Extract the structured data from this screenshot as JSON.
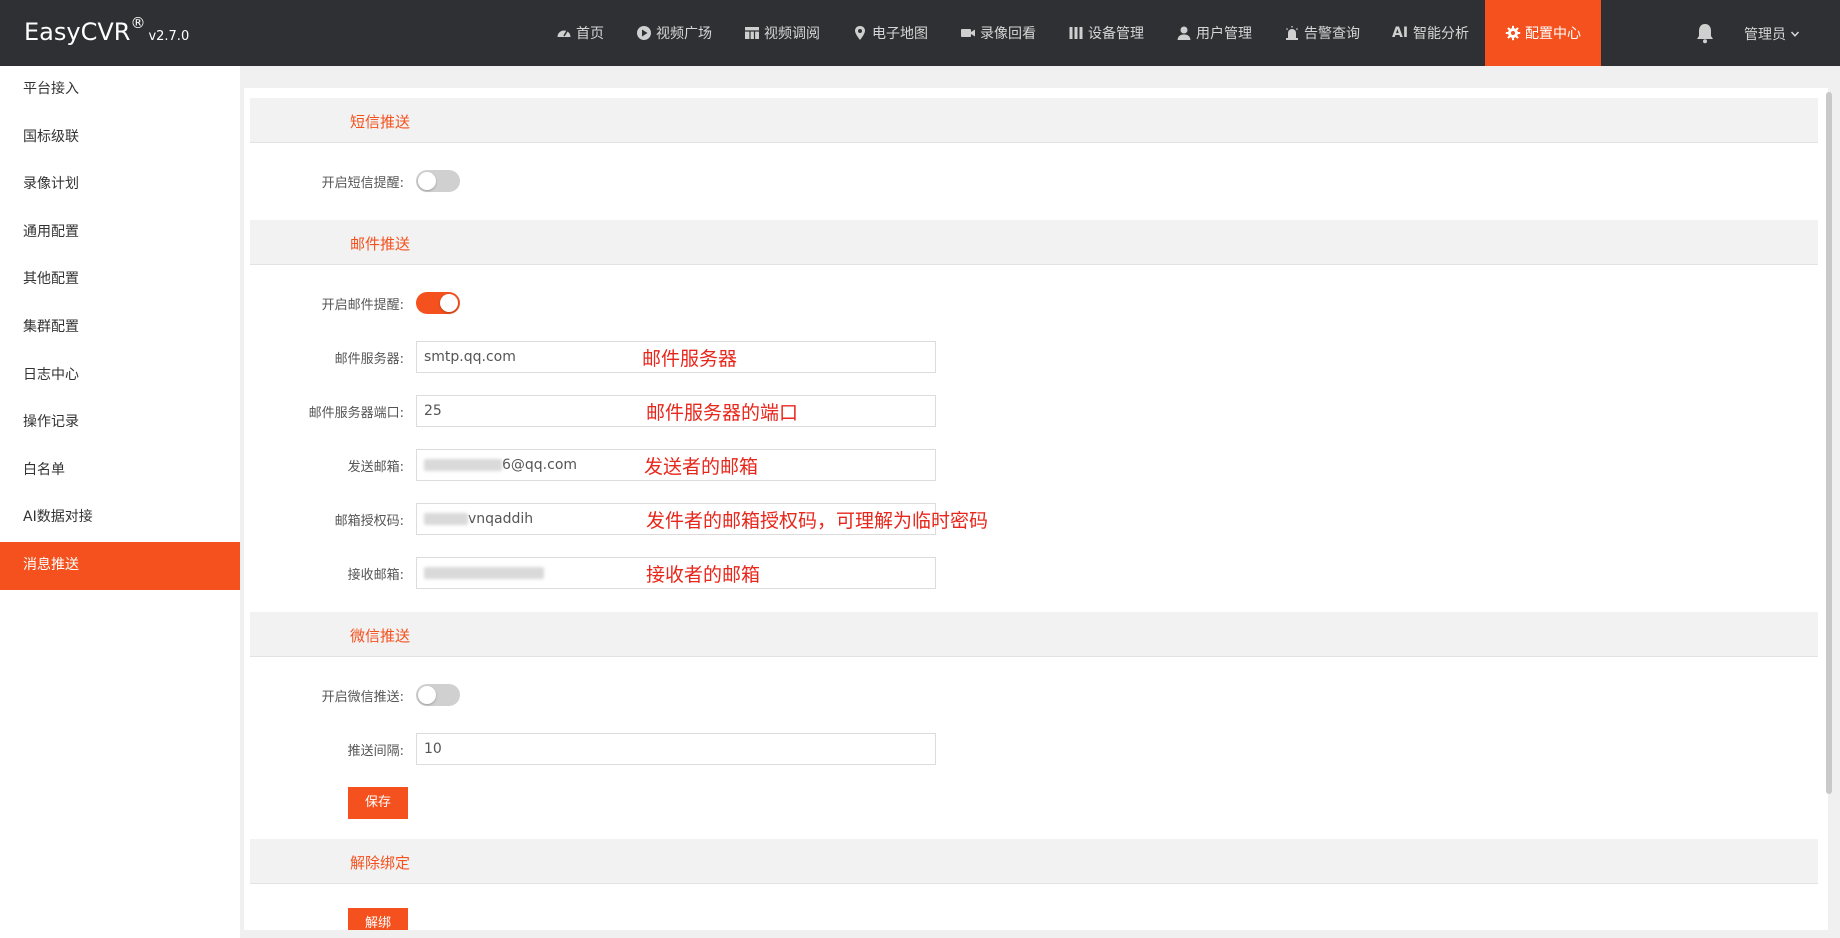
{
  "app": {
    "brand": "EasyCVR",
    "brand_mark": "®",
    "version": "v2.7.0"
  },
  "nav": [
    {
      "label": "首页",
      "icon": "dashboard-icon"
    },
    {
      "label": "视频广场",
      "icon": "play-circle-icon"
    },
    {
      "label": "视频调阅",
      "icon": "grid-icon"
    },
    {
      "label": "电子地图",
      "icon": "map-pin-icon"
    },
    {
      "label": "录像回看",
      "icon": "video-camera-icon"
    },
    {
      "label": "设备管理",
      "icon": "device-icon"
    },
    {
      "label": "用户管理",
      "icon": "user-icon"
    },
    {
      "label": "告警查询",
      "icon": "alarm-icon"
    },
    {
      "label": "智能分析",
      "icon": "ai-icon",
      "icon_text": "AI"
    },
    {
      "label": "配置中心",
      "icon": "gear-icon"
    }
  ],
  "user": {
    "label": "管理员",
    "icon": "chevron-down-icon"
  },
  "sidebar": {
    "items": [
      {
        "label": "平台接入"
      },
      {
        "label": "国标级联"
      },
      {
        "label": "录像计划"
      },
      {
        "label": "通用配置"
      },
      {
        "label": "其他配置"
      },
      {
        "label": "集群配置"
      },
      {
        "label": "日志中心"
      },
      {
        "label": "操作记录"
      },
      {
        "label": "白名单"
      },
      {
        "label": "AI数据对接"
      },
      {
        "label": "消息推送"
      }
    ]
  },
  "sms": {
    "title": "短信推送",
    "enable_label": "开启短信提醒:",
    "enabled": false
  },
  "email": {
    "title": "邮件推送",
    "enable_label": "开启邮件提醒:",
    "enabled": true,
    "server_label": "邮件服务器:",
    "server_value": "smtp.qq.com",
    "port_label": "邮件服务器端口:",
    "port_value": "25",
    "sender_label": "发送邮箱:",
    "sender_value_suffix": "6@qq.com",
    "auth_label": "邮箱授权码:",
    "auth_value_suffix": "vnqaddih",
    "receiver_label": "接收邮箱:"
  },
  "annotations": {
    "server": "邮件服务器",
    "port": "邮件服务器的端口",
    "sender": "发送者的邮箱",
    "auth": "发件者的邮箱授权码，可理解为临时密码",
    "receiver": "接收者的邮箱"
  },
  "wechat": {
    "title": "微信推送",
    "enable_label": "开启微信推送:",
    "enabled": false,
    "interval_label": "推送间隔:",
    "interval_value": "10",
    "save_label": "保存"
  },
  "unbind": {
    "title": "解除绑定",
    "button_label": "解绑"
  },
  "colors": {
    "accent": "#f4511e",
    "topbar": "#2e3033",
    "annotation": "#e8271c"
  }
}
